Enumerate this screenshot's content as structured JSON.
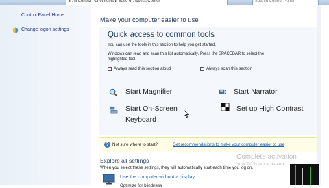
{
  "toolbar": {
    "breadcrumb": "▸ All Control Panel Items ▸ Ease of Access Center",
    "search_placeholder": "Search Control Panel"
  },
  "sidebar": {
    "items": [
      {
        "label": "Control Panel Home"
      },
      {
        "label": "Change logon settings"
      }
    ]
  },
  "main": {
    "heading": "Make your computer easier to use",
    "quick_access": {
      "title": "Quick access to common tools",
      "line1": "You can use the tools in this section to help you get started.",
      "line2": "Windows can read and scan this list automatically.  Press the SPACEBAR to select the",
      "line3": "highlighted tool.",
      "checkbox_read": "Always read this section aloud",
      "checkbox_scan": "Always scan this section",
      "tools": {
        "magnifier": "Start Magnifier",
        "narrator": "Start Narrator",
        "keyboard_line1": "Start On-Screen",
        "keyboard_line2": "Keyboard",
        "contrast": "Set up High Contrast"
      }
    },
    "hint": {
      "question": "Not sure where to start?",
      "link": "Get recommendations to make your computer easier to use"
    },
    "explore": {
      "title": "Explore all settings",
      "text": "When you select these settings, they will automatically start each time you log on.",
      "link": "Use the computer without a display",
      "sub": "Optimize for blindness"
    }
  },
  "watermark": {
    "line1": "Complete activation",
    "line2": "Your PC is not activated"
  },
  "colors": {
    "heading": "#1e395b",
    "link": "#1a5fb4",
    "panel_bg": "#f4f8fc",
    "hint_bg": "#fffde6"
  }
}
